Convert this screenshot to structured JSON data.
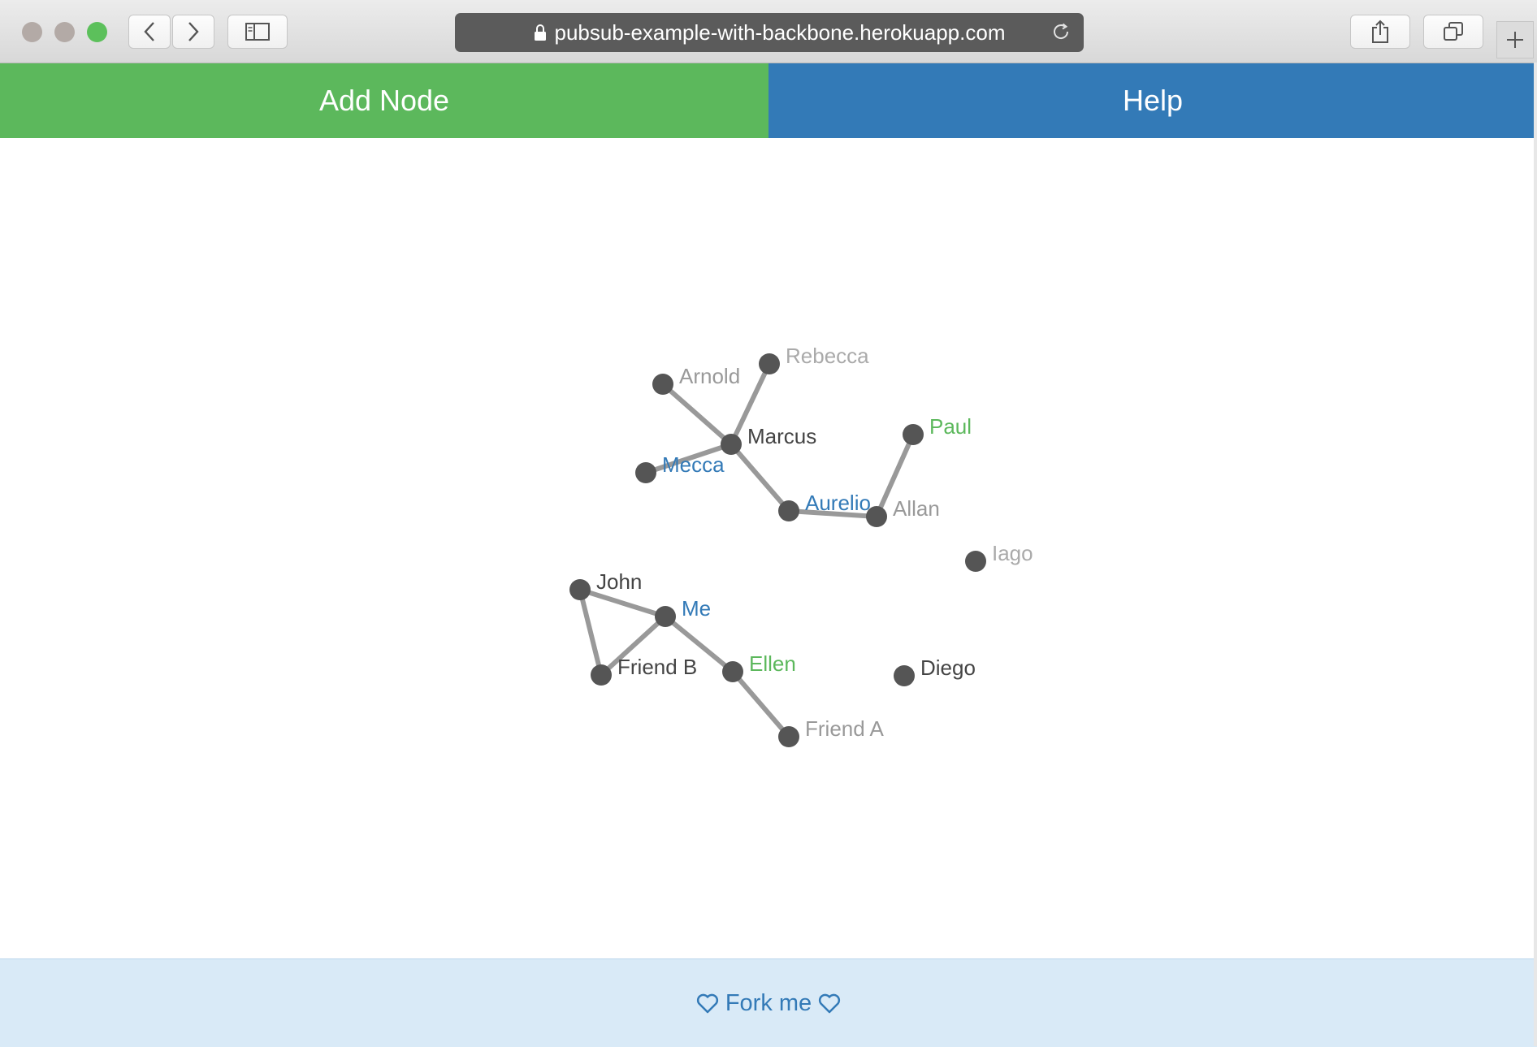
{
  "browser": {
    "url": "pubsub-example-with-backbone.herokuapp.com",
    "traffic_lights": {
      "close": "#b3aaa6",
      "minimize": "#b3aaa6",
      "zoom": "#5cc05b"
    },
    "icons": [
      "back-icon",
      "forward-icon",
      "sidebar-icon",
      "lock-icon",
      "reload-icon",
      "share-icon",
      "tabs-icon",
      "new-tab-icon"
    ]
  },
  "header": {
    "add_node_label": "Add Node",
    "help_label": "Help",
    "colors": {
      "add_node": "#5cb85c",
      "help": "#337ab7"
    }
  },
  "graph": {
    "node_color": "#555555",
    "link_color": "#999999",
    "label_colors": {
      "default": "#444444",
      "blue": "#337ab7",
      "green": "#5cb85c",
      "muted": "#999999",
      "faded": "#aaaaaa"
    },
    "nodes": [
      {
        "id": "rebecca",
        "label": "Rebecca",
        "style": "faded"
      },
      {
        "id": "arnold",
        "label": "Arnold",
        "style": "muted"
      },
      {
        "id": "marcus",
        "label": "Marcus",
        "style": "default"
      },
      {
        "id": "mecca",
        "label": "Mecca",
        "style": "blue"
      },
      {
        "id": "paul",
        "label": "Paul",
        "style": "green"
      },
      {
        "id": "aurelio",
        "label": "Aurelio",
        "style": "blue"
      },
      {
        "id": "allan",
        "label": "Allan",
        "style": "muted"
      },
      {
        "id": "iago",
        "label": "Iago",
        "style": "faded"
      },
      {
        "id": "john",
        "label": "John",
        "style": "default"
      },
      {
        "id": "me",
        "label": "Me",
        "style": "blue"
      },
      {
        "id": "friend-b",
        "label": "Friend B",
        "style": "default"
      },
      {
        "id": "ellen",
        "label": "Ellen",
        "style": "green"
      },
      {
        "id": "diego",
        "label": "Diego",
        "style": "default"
      },
      {
        "id": "friend-a",
        "label": "Friend A",
        "style": "muted"
      }
    ],
    "links": [
      [
        "arnold",
        "marcus"
      ],
      [
        "rebecca",
        "marcus"
      ],
      [
        "mecca",
        "marcus"
      ],
      [
        "marcus",
        "aurelio"
      ],
      [
        "aurelio",
        "allan"
      ],
      [
        "paul",
        "allan"
      ],
      [
        "john",
        "me"
      ],
      [
        "john",
        "friend-b"
      ],
      [
        "friend-b",
        "me"
      ],
      [
        "me",
        "ellen"
      ],
      [
        "ellen",
        "friend-a"
      ]
    ]
  },
  "footer": {
    "fork_label": "Fork me",
    "icon": "heart-icon"
  }
}
